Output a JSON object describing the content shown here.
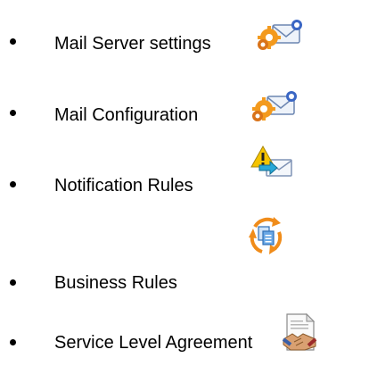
{
  "items": [
    {
      "label": "Mail Server settings",
      "icon": "mail-settings-icon"
    },
    {
      "label": "Mail Configuration",
      "icon": "mail-settings-icon"
    },
    {
      "label": "Notification Rules",
      "icon": "warning-mail-icon"
    },
    {
      "label": "Business Rules",
      "icon": "rules-cycle-icon"
    },
    {
      "label": "Service Level Agreement",
      "icon": "agreement-handshake-icon"
    }
  ],
  "colors": {
    "gear": "#f39a1e",
    "envelope": "#eef3fa",
    "envelope_stroke": "#6c86b1",
    "badge": "#3a66c4",
    "warning": "#f5c400",
    "arrow": "#27a8d8",
    "cycle": "#f08c1a",
    "document": "#6aa8e6"
  }
}
